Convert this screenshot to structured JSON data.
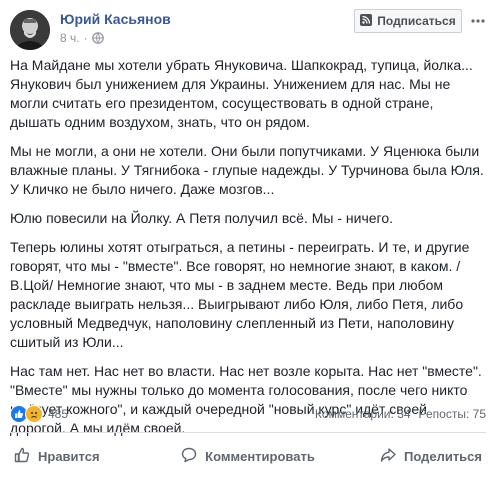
{
  "post": {
    "author": "Юрий Касьянов",
    "time": "8 ч.",
    "subscribe_label": "Подписаться",
    "paragraphs": [
      "На Майдане мы хотели убрать Януковича. Шапкокрад, тупица, йолка... Янукович был унижением для Украины. Унижением для нас. Мы не могли считать его президентом, сосуществовать в одной стране, дышать одним воздухом, знать, что он рядом.",
      "Мы не могли, а они не хотели. Они были попутчиками. У Яценюка были влажные планы. У Тягнибока - глупые надежды. У Турчинова была Юля. У Кличко не было ничего. Даже мозгов...",
      "Юлю повесили на Йолку. А Петя получил всё. Мы - ничего.",
      "Теперь юлины хотят отыграться, а петины - переиграть. И те, и другие говорят, что мы - \"вместе\". Все говорят, но немногие знают, в каком. / В.Цой/ Немногие знают, что мы - в заднем месте. Ведь при любом раскладе выиграть нельзя... Выигрывают либо Юля, либо Петя, либо условный Медведчук, наполовину слепленный из Пети, наполовину сшитый из Юли...",
      "Нас там нет. Нас нет во власти. Нас нет возле корыта. Нас нет \"вместе\". \"Вместе\" мы нужны только до момента голосования, после чего никто не \"чует кожного\", и каждый очередной \"новый курс\" идёт своей дорогой. А мы идём своей."
    ]
  },
  "stats": {
    "reactions_count": "485",
    "comments": "Комментарии: 34",
    "reposts": "Репосты: 75"
  },
  "actions": {
    "like": "Нравится",
    "comment": "Комментировать",
    "share": "Поделиться"
  },
  "icons": {
    "like": "like-icon",
    "sad": "sad-icon",
    "globe": "globe-icon",
    "subscribe": "rss-icon",
    "more": "more-icon",
    "comment": "comment-icon",
    "share": "share-icon"
  },
  "colors": {
    "author": "#385898",
    "like_blue": "#1877f2",
    "sad_yellow": "#f7b125",
    "muted": "#606770"
  }
}
